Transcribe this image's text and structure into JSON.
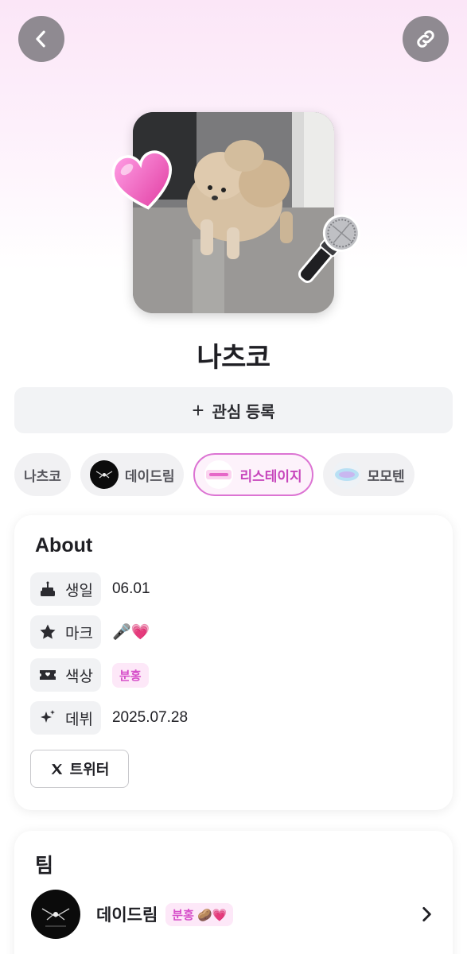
{
  "header": {
    "back_icon": "chevron-left-icon",
    "share_icon": "link-icon"
  },
  "profile": {
    "name": "나츠코",
    "follow_label": "관심 등록",
    "follow_icon": "+",
    "stickers": [
      "heart",
      "microphone"
    ]
  },
  "chips": [
    {
      "label": "나츠코",
      "logo": null,
      "active": false
    },
    {
      "label": "데이드림",
      "logo": "daydream-logo",
      "active": false
    },
    {
      "label": "리스테이지",
      "logo": "restage-logo",
      "active": true
    },
    {
      "label": "모모텐",
      "logo": "momoten-logo",
      "active": false
    }
  ],
  "about": {
    "title": "About",
    "rows": [
      {
        "label": "생일",
        "icon": "cake-icon",
        "value": "06.01"
      },
      {
        "label": "마크",
        "icon": "star-icon",
        "value": "🎤💗"
      },
      {
        "label": "색상",
        "icon": "ticket-icon",
        "value": "분홍"
      },
      {
        "label": "데뷔",
        "icon": "sparkle-icon",
        "value": "2025.07.28"
      }
    ],
    "twitter_label": "트위터"
  },
  "team": {
    "title": "팀",
    "items": [
      {
        "name": "데이드림",
        "badge": "분홍 🥔💗"
      }
    ]
  },
  "colors": {
    "accent_pink": "#d64fc9",
    "chip_active_border": "#dc74d3",
    "button_gray": "#8f8a91"
  }
}
